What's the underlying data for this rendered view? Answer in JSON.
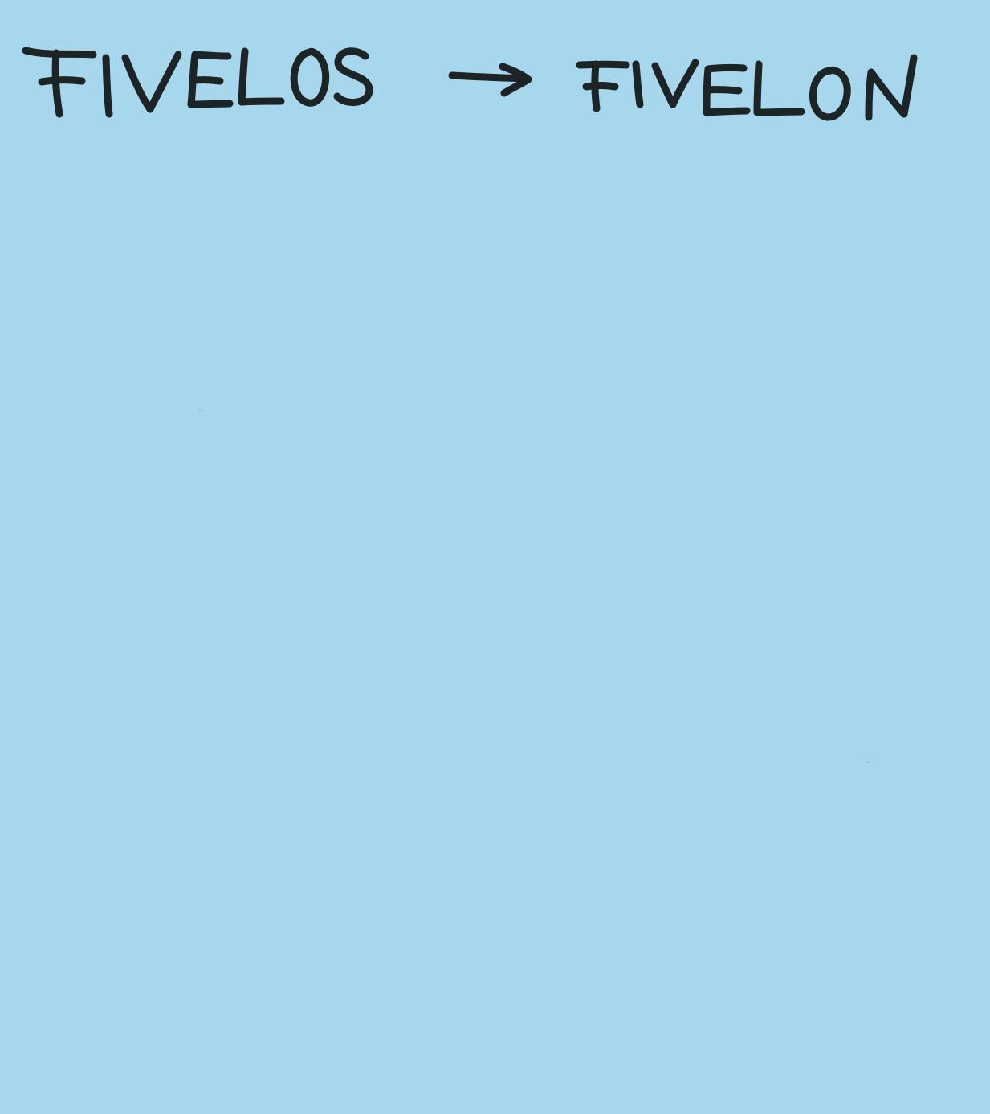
{
  "note": {
    "background_color": "#a6d7ec",
    "ink_color": "#1c2426",
    "speck_color": "#7fa7b8"
  },
  "handwriting": {
    "from_word": "FIVELOS",
    "arrow": "→",
    "to_word": "FIVELON"
  }
}
